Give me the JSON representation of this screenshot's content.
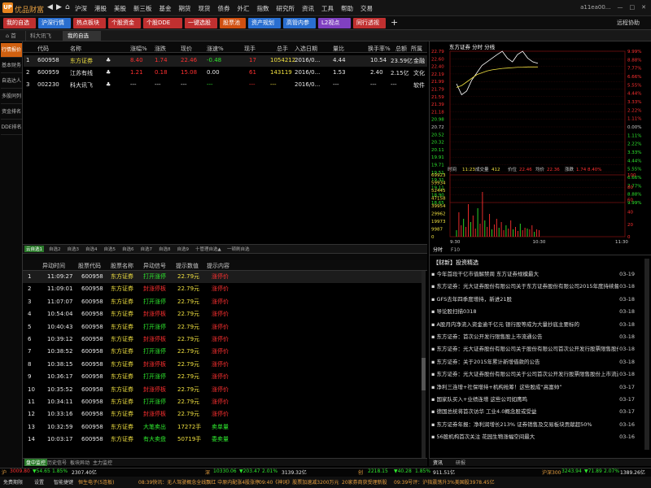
{
  "app": {
    "name": "优品财富",
    "user": "a11ea00..."
  },
  "menu": [
    "沪深",
    "港股",
    "美股",
    "新三板",
    "基金",
    "期货",
    "现货",
    "债券",
    "外汇",
    "指数",
    "研究所",
    "资讯",
    "工具",
    "帮助",
    "交易"
  ],
  "topright": [
    "远程协助"
  ],
  "toolbar": [
    {
      "label": "我的自选",
      "color": "#c03030"
    },
    {
      "label": "沪深行情",
      "color": "#2a6fd0"
    },
    {
      "label": "热点板块",
      "color": "#c03030"
    },
    {
      "label": "个股资金",
      "color": "#c03030"
    },
    {
      "label": "个股DDE",
      "color": "#c03030"
    },
    {
      "label": "一键选股",
      "color": "#c03030"
    },
    {
      "label": "股票池",
      "color": "#d05010"
    },
    {
      "label": "资产规划",
      "color": "#2a6fd0"
    },
    {
      "label": "高管内参",
      "color": "#2a6fd0"
    },
    {
      "label": "L2视点",
      "color": "#8040c0"
    },
    {
      "label": "同行透视",
      "color": "#c03030"
    }
  ],
  "tabs3": [
    "首页",
    "科大讯飞",
    "我的自选"
  ],
  "leftnav": [
    "行情报价",
    "基本财务",
    "自选达人",
    "多股同列",
    "资金排名",
    "DDE排名"
  ],
  "grid": {
    "headers": [
      "代码",
      "名称",
      "",
      "涨幅%",
      "涨跌",
      "现价",
      "涨速%",
      "现手",
      "总手",
      "入选日期",
      "量比",
      "换手率%",
      "总额",
      "所属"
    ],
    "rows": [
      {
        "no": "1",
        "code": "600958",
        "name": "东方证券",
        "pct": "8.40",
        "chg": "1.74",
        "price": "22.46",
        "speed": "-0.48",
        "vol": "17",
        "total": "1054212",
        "date": "2016/0...",
        "ratio": "4.44",
        "turn": "10.54",
        "amt": "23.59亿",
        "ind": "金融"
      },
      {
        "no": "2",
        "code": "600959",
        "name": "江苏有线",
        "pct": "1.21",
        "chg": "0.18",
        "price": "15.08",
        "speed": "0.00",
        "vol": "61",
        "total": "143119",
        "date": "2016/0...",
        "ratio": "1.53",
        "turn": "2.40",
        "amt": "2.15亿",
        "ind": "文化"
      },
      {
        "no": "3",
        "code": "002230",
        "name": "科大讯飞",
        "pct": "---",
        "chg": "---",
        "price": "---",
        "speed": "---",
        "vol": "---",
        "total": "---",
        "date": "2016/0...",
        "ratio": "---",
        "turn": "---",
        "amt": "---",
        "ind": "软件"
      }
    ]
  },
  "split_tabs": [
    "云自选1",
    "自选2",
    "自选3",
    "自选4",
    "自选5",
    "自选6",
    "自选7",
    "自选8",
    "自选9",
    "十管理自选▲",
    "一顿刷自选"
  ],
  "alerts": {
    "headers": [
      "异动时间",
      "股票代码",
      "股票名称",
      "异动信号",
      "提示数值",
      "提示内容"
    ],
    "rows": [
      {
        "no": "1",
        "time": "11:09:27",
        "code": "600958",
        "name": "东方证券",
        "sig": "打开涨停",
        "sc": "green",
        "val": "22.79元",
        "msg": "涨停价",
        "mc": "red"
      },
      {
        "no": "2",
        "time": "11:09:01",
        "code": "600958",
        "name": "东方证券",
        "sig": "封涨停板",
        "sc": "red",
        "val": "22.79元",
        "msg": "涨停价",
        "mc": "red"
      },
      {
        "no": "3",
        "time": "11:07:07",
        "code": "600958",
        "name": "东方证券",
        "sig": "打开涨停",
        "sc": "green",
        "val": "22.79元",
        "msg": "涨停价",
        "mc": "red"
      },
      {
        "no": "4",
        "time": "10:54:04",
        "code": "600958",
        "name": "东方证券",
        "sig": "封涨停板",
        "sc": "red",
        "val": "22.79元",
        "msg": "涨停价",
        "mc": "red"
      },
      {
        "no": "5",
        "time": "10:40:43",
        "code": "600958",
        "name": "东方证券",
        "sig": "打开涨停",
        "sc": "green",
        "val": "22.79元",
        "msg": "涨停价",
        "mc": "red"
      },
      {
        "no": "6",
        "time": "10:39:12",
        "code": "600958",
        "name": "东方证券",
        "sig": "封涨停板",
        "sc": "red",
        "val": "22.79元",
        "msg": "涨停价",
        "mc": "red"
      },
      {
        "no": "7",
        "time": "10:38:52",
        "code": "600958",
        "name": "东方证券",
        "sig": "打开涨停",
        "sc": "green",
        "val": "22.79元",
        "msg": "涨停价",
        "mc": "red"
      },
      {
        "no": "8",
        "time": "10:38:15",
        "code": "600958",
        "name": "东方证券",
        "sig": "封涨停板",
        "sc": "red",
        "val": "22.79元",
        "msg": "涨停价",
        "mc": "red"
      },
      {
        "no": "9",
        "time": "10:36:17",
        "code": "600958",
        "name": "东方证券",
        "sig": "打开涨停",
        "sc": "green",
        "val": "22.79元",
        "msg": "涨停价",
        "mc": "red"
      },
      {
        "no": "10",
        "time": "10:35:52",
        "code": "600958",
        "name": "东方证券",
        "sig": "封涨停板",
        "sc": "red",
        "val": "22.79元",
        "msg": "涨停价",
        "mc": "red"
      },
      {
        "no": "11",
        "time": "10:34:11",
        "code": "600958",
        "name": "东方证券",
        "sig": "打开涨停",
        "sc": "green",
        "val": "22.79元",
        "msg": "涨停价",
        "mc": "red"
      },
      {
        "no": "12",
        "time": "10:33:16",
        "code": "600958",
        "name": "东方证券",
        "sig": "封涨停板",
        "sc": "red",
        "val": "22.79元",
        "msg": "涨停价",
        "mc": "red"
      },
      {
        "no": "13",
        "time": "10:32:59",
        "code": "600958",
        "name": "东方证券",
        "sig": "大笔卖出",
        "sc": "green",
        "val": "17272手",
        "msg": "卖单量",
        "mc": "green"
      },
      {
        "no": "14",
        "time": "10:03:17",
        "code": "600958",
        "name": "东方证券",
        "sig": "有大卖盘",
        "sc": "green",
        "val": "50719手",
        "msg": "委卖量",
        "mc": "green"
      }
    ]
  },
  "bottom_tabs": [
    "盘中监控",
    "历史信号",
    "板块异动",
    "主力监控"
  ],
  "minute_chart": {
    "title": "东方证券  分时  分线",
    "prices_left": [
      "22.79",
      "22.60",
      "22.40",
      "22.19",
      "21.99",
      "21.79",
      "21.59",
      "21.39",
      "21.18",
      "20.98",
      "20.72",
      "20.52",
      "20.32",
      "20.11",
      "19.91",
      "19.71",
      "19.51",
      "19.31",
      "19.11",
      "18.90",
      "18.65"
    ],
    "pct_right": [
      "9.99%",
      "8.88%",
      "7.77%",
      "6.66%",
      "5.55%",
      "4.44%",
      "3.33%",
      "2.22%",
      "1.11%",
      "0.00%",
      "1.11%",
      "2.22%",
      "3.33%",
      "4.44%",
      "5.55%",
      "6.66%",
      "7.77%",
      "8.88%",
      "9.99%"
    ],
    "vol_left": [
      "69923",
      "59934",
      "52445",
      "47158",
      "39954",
      "29962",
      "19973",
      "9987",
      "0"
    ],
    "vol_right": [
      "100",
      "80",
      "60",
      "40",
      "20",
      "0"
    ],
    "info": {
      "time_label": "时间",
      "time": "11:23",
      "cjl_label": "成交量",
      "cjl": "412",
      "price_label": "价位",
      "price": "22.46",
      "avg_label": "均价",
      "avg": "22.36",
      "pct_label": "涨跌",
      "pct": "1.74 8.40%"
    },
    "xaxis": [
      "9:30",
      "10:30",
      "11:30"
    ],
    "tabs": [
      "分时",
      "F10"
    ]
  },
  "news": {
    "title": "【财新】投资精选",
    "items": [
      {
        "t": "今年首段干亿市值解禁周 东方证券规模最大",
        "d": "03-19"
      },
      {
        "t": "东方证券：光大证券股份有限公司关于东方证券股份有限公司2015年度持续督导年度报告",
        "d": "03-18"
      },
      {
        "t": "GFS去年四季度增持，新进21股",
        "d": "03-18"
      },
      {
        "t": "导论股扫描0318",
        "d": "03-18"
      },
      {
        "t": "A股月内净流入资金逾千亿元 银行股等成为大量抄底主要标的",
        "d": "03-18"
      },
      {
        "t": "东方证券：首次公开发行限售股上市流通公告",
        "d": "03-18"
      },
      {
        "t": "东方证券：光大证券股份有限公司关于股份有限公司首次公开发行股票限售股份上市流...",
        "d": "03-18"
      },
      {
        "t": "东方证券：关于2015年累计新增借款的公告",
        "d": "03-18"
      },
      {
        "t": "东方证券：光大证券股份有限公司关于公司首次公开发行股票限售股份上市流通的核查...",
        "d": "03-18"
      },
      {
        "t": "净利三连增+社保增持+机构抢筹！这些股成“高富帅”",
        "d": "03-17"
      },
      {
        "t": "国家队买入+业绩连增 这些公司如鹰鸣",
        "d": "03-17"
      },
      {
        "t": "德国总统将首次访华 工业4.0概念股或受益",
        "d": "03-17"
      },
      {
        "t": "东方证券年报：净利润增长213% 证券销售及交易板块贡献超50%",
        "d": "03-16"
      },
      {
        "t": "56股机构首次关注 花园生物涨幅空间最大",
        "d": "03-16"
      }
    ],
    "tabs": [
      "资讯",
      "研报"
    ]
  },
  "status1": {
    "sh": "沪",
    "sh_val": "3009.80",
    "sh_chg": "▼54.65",
    "sh_pct": "1.85%",
    "sh_amt": "2307.40亿",
    "sz": "深",
    "sz_val": "10330.06",
    "sz_chg": "▼203.47",
    "sz_pct": "2.01%",
    "sz_amt": "3139.32亿",
    "cy": "创",
    "cy_val": "2218.15",
    "cy_chg": "▼40.28",
    "cy_pct": "1.85%",
    "cy_amt": "911.51亿",
    "hs": "沪深300",
    "hs_val": "3243.94",
    "hs_chg": "▼71.89",
    "hs_pct": "2.07%",
    "hs_amt": "1389.26亿"
  },
  "status2": {
    "items": [
      "免费期限",
      "设置",
      "智能捷键",
      "恒生电子(5连板)",
      "08:39快讯：无人驾驶概念全线飘红 中原内配涨4股涨停",
      "09:40《神词》股票加速减3200万元",
      "20家券商获受理新股",
      "09:39号评：沪指震荡升3%美国股3978.45亿"
    ]
  }
}
